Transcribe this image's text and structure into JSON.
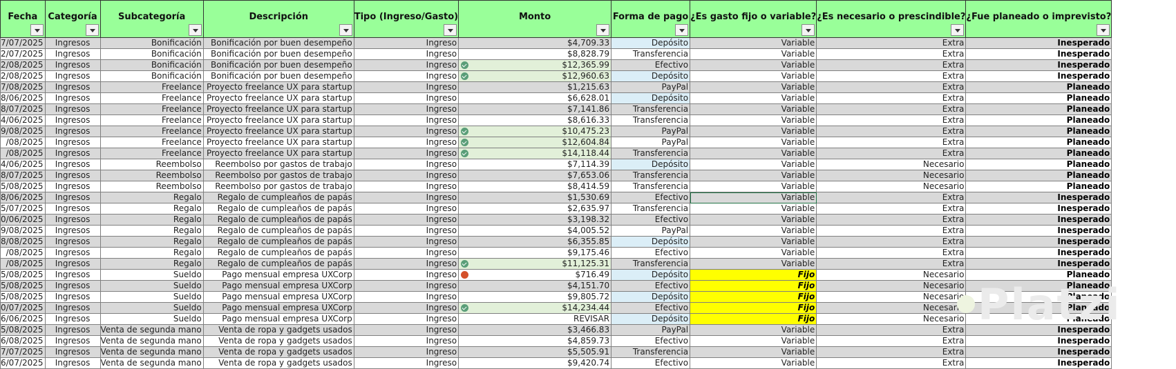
{
  "headers": [
    "Fecha",
    "Categoría",
    "Subcategoría",
    "Descripción",
    "Tipo (Ingreso/Gasto)",
    "Monto",
    "Forma de pago",
    "¿Es gasto fijo o variable?",
    "¿Es necesario o prescindible?",
    "¿Fue planeado o imprevisto?"
  ],
  "rows": [
    [
      "7/07/2025",
      "Ingresos",
      "Bonificación",
      "Bonificación por buen desempeño",
      "Ingreso",
      "$4,709.33",
      "Depósito",
      "Variable",
      "Extra",
      "Inesperado"
    ],
    [
      "2/07/2025",
      "Ingresos",
      "Bonificación",
      "Bonificación por buen desempeño",
      "Ingreso",
      "$8,828.79",
      "Transferencia",
      "Variable",
      "Extra",
      "Inesperado"
    ],
    [
      "2/08/2025",
      "Ingresos",
      "Bonificación",
      "Bonificación por buen desempeño",
      "Ingreso",
      "$12,365.99",
      "Efectivo",
      "Variable",
      "Extra",
      "Inesperado"
    ],
    [
      "2/08/2025",
      "Ingresos",
      "Bonificación",
      "Bonificación por buen desempeño",
      "Ingreso",
      "$12,960.63",
      "Depósito",
      "Variable",
      "Extra",
      "Inesperado"
    ],
    [
      "7/08/2025",
      "Ingresos",
      "Freelance",
      "Proyecto freelance UX para startup",
      "Ingreso",
      "$1,215.63",
      "PayPal",
      "Variable",
      "Extra",
      "Planeado"
    ],
    [
      "8/06/2025",
      "Ingresos",
      "Freelance",
      "Proyecto freelance UX para startup",
      "Ingreso",
      "$6,628.01",
      "Depósito",
      "Variable",
      "Extra",
      "Planeado"
    ],
    [
      "8/07/2025",
      "Ingresos",
      "Freelance",
      "Proyecto freelance UX para startup",
      "Ingreso",
      "$7,141.86",
      "Transferencia",
      "Variable",
      "Extra",
      "Planeado"
    ],
    [
      "4/06/2025",
      "Ingresos",
      "Freelance",
      "Proyecto freelance UX para startup",
      "Ingreso",
      "$8,616.33",
      "Transferencia",
      "Variable",
      "Extra",
      "Planeado"
    ],
    [
      "9/08/2025",
      "Ingresos",
      "Freelance",
      "Proyecto freelance UX para startup",
      "Ingreso",
      "$10,475.23",
      "PayPal",
      "Variable",
      "Extra",
      "Planeado"
    ],
    [
      "/08/2025",
      "Ingresos",
      "Freelance",
      "Proyecto freelance UX para startup",
      "Ingreso",
      "$12,604.84",
      "PayPal",
      "Variable",
      "Extra",
      "Planeado"
    ],
    [
      "/08/2025",
      "Ingresos",
      "Freelance",
      "Proyecto freelance UX para startup",
      "Ingreso",
      "$14,118.44",
      "Transferencia",
      "Variable",
      "Extra",
      "Planeado"
    ],
    [
      "4/06/2025",
      "Ingresos",
      "Reembolso",
      "Reembolso por gastos de trabajo",
      "Ingreso",
      "$7,114.39",
      "Depósito",
      "Variable",
      "Necesario",
      "Planeado"
    ],
    [
      "8/07/2025",
      "Ingresos",
      "Reembolso",
      "Reembolso por gastos de trabajo",
      "Ingreso",
      "$7,653.06",
      "Transferencia",
      "Variable",
      "Necesario",
      "Planeado"
    ],
    [
      "5/08/2025",
      "Ingresos",
      "Reembolso",
      "Reembolso por gastos de trabajo",
      "Ingreso",
      "$8,414.59",
      "Transferencia",
      "Variable",
      "Necesario",
      "Planeado"
    ],
    [
      "8/06/2025",
      "Ingresos",
      "Regalo",
      "Regalo de cumpleaños de papás",
      "Ingreso",
      "$1,530.69",
      "Efectivo",
      "Variable",
      "Extra",
      "Inesperado"
    ],
    [
      "5/07/2025",
      "Ingresos",
      "Regalo",
      "Regalo de cumpleaños de papás",
      "Ingreso",
      "$2,635.97",
      "Transferencia",
      "Variable",
      "Extra",
      "Inesperado"
    ],
    [
      "0/06/2025",
      "Ingresos",
      "Regalo",
      "Regalo de cumpleaños de papás",
      "Ingreso",
      "$3,198.32",
      "Efectivo",
      "Variable",
      "Extra",
      "Inesperado"
    ],
    [
      "9/08/2025",
      "Ingresos",
      "Regalo",
      "Regalo de cumpleaños de papás",
      "Ingreso",
      "$4,005.52",
      "PayPal",
      "Variable",
      "Extra",
      "Inesperado"
    ],
    [
      "8/08/2025",
      "Ingresos",
      "Regalo",
      "Regalo de cumpleaños de papás",
      "Ingreso",
      "$6,355.85",
      "Depósito",
      "Variable",
      "Extra",
      "Inesperado"
    ],
    [
      "/08/2025",
      "Ingresos",
      "Regalo",
      "Regalo de cumpleaños de papás",
      "Ingreso",
      "$9,175.46",
      "Efectivo",
      "Variable",
      "Extra",
      "Inesperado"
    ],
    [
      "/08/2025",
      "Ingresos",
      "Regalo",
      "Regalo de cumpleaños de papás",
      "Ingreso",
      "$11,125.31",
      "Transferencia",
      "Variable",
      "Extra",
      "Inesperado"
    ],
    [
      "5/08/2025",
      "Ingresos",
      "Sueldo",
      "Pago mensual empresa UXCorp",
      "Ingreso",
      "$716.49",
      "Depósito",
      "Fijo",
      "Necesario",
      "Planeado"
    ],
    [
      "5/08/2025",
      "Ingresos",
      "Sueldo",
      "Pago mensual empresa UXCorp",
      "Ingreso",
      "$4,151.70",
      "Efectivo",
      "Fijo",
      "Necesario",
      "Planeado"
    ],
    [
      "5/08/2025",
      "Ingresos",
      "Sueldo",
      "Pago mensual empresa UXCorp",
      "Ingreso",
      "$9,805.72",
      "Depósito",
      "Fijo",
      "Necesario",
      "Planeado"
    ],
    [
      "0/07/2025",
      "Ingresos",
      "Sueldo",
      "Pago mensual empresa UXCorp",
      "Ingreso",
      "$14,234.44",
      "Efectivo",
      "Fijo",
      "Necesario",
      "Planeado"
    ],
    [
      "6/06/2025",
      "Ingresos",
      "Sueldo",
      "Pago mensual empresa UXCorp",
      "Ingreso",
      "REVISAR",
      "Depósito",
      "Fijo",
      "Necesario",
      "Planeado"
    ],
    [
      "5/08/2025",
      "Ingresos",
      "Venta de segunda mano",
      "Venta de ropa y gadgets usados",
      "Ingreso",
      "$3,466.83",
      "PayPal",
      "Variable",
      "Extra",
      "Inesperado"
    ],
    [
      "6/08/2025",
      "Ingresos",
      "Venta de segunda mano",
      "Venta de ropa y gadgets usados",
      "Ingreso",
      "$4,859.73",
      "Efectivo",
      "Variable",
      "Extra",
      "Inesperado"
    ],
    [
      "7/07/2025",
      "Ingresos",
      "Venta de segunda mano",
      "Venta de ropa y gadgets usados",
      "Ingreso",
      "$5,505.91",
      "Transferencia",
      "Variable",
      "Extra",
      "Inesperado"
    ],
    [
      "6/07/2025",
      "Ingresos",
      "Venta de segunda mano",
      "Venta de ropa y gadgets usados",
      "Ingreso",
      "$9,420.74",
      "Efectivo",
      "Variable",
      "Extra",
      "Inesperado"
    ]
  ],
  "monto_icons": {
    "2": "check",
    "3": "check",
    "8": "check",
    "9": "check",
    "10": "check",
    "20": "check",
    "21": "alert",
    "24": "check"
  },
  "colors": {
    "header": "#99ff99",
    "band": "#d9d9d9",
    "deposit": "#dbeef7",
    "high_amount": "#e2f0d9",
    "fixed": "#ffff00",
    "check_icon": "#5a9e78",
    "alert_icon": "#d4502a"
  },
  "watermark": "Platzi"
}
